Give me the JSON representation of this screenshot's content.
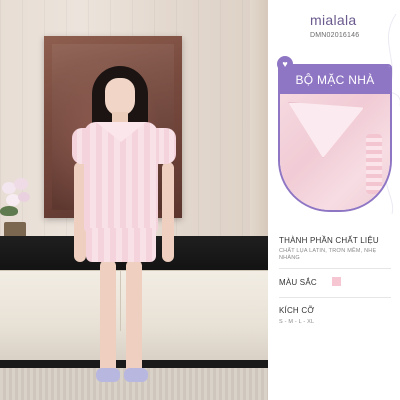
{
  "brand": {
    "name": "mialala",
    "sku": "DMN02016146"
  },
  "product": {
    "title": "BỘ MẶC NHÀ",
    "badge_icon": "heart-icon"
  },
  "sections": {
    "material": {
      "label": "THÀNH PHẦN CHẤT LIỆU",
      "text": "CHẤT LỤA LATIN, TRƠN MỀM, NHẸ NHÀNG"
    },
    "color": {
      "label": "MÀU SẮC",
      "swatch": "#f6c7d3"
    },
    "size": {
      "label": "KÍCH CỠ",
      "text": "S - M - L - XL"
    }
  },
  "colors": {
    "accent": "#8f76c4",
    "brand_text": "#6b5a8e",
    "fabric_pink": "#f5d3dc"
  }
}
